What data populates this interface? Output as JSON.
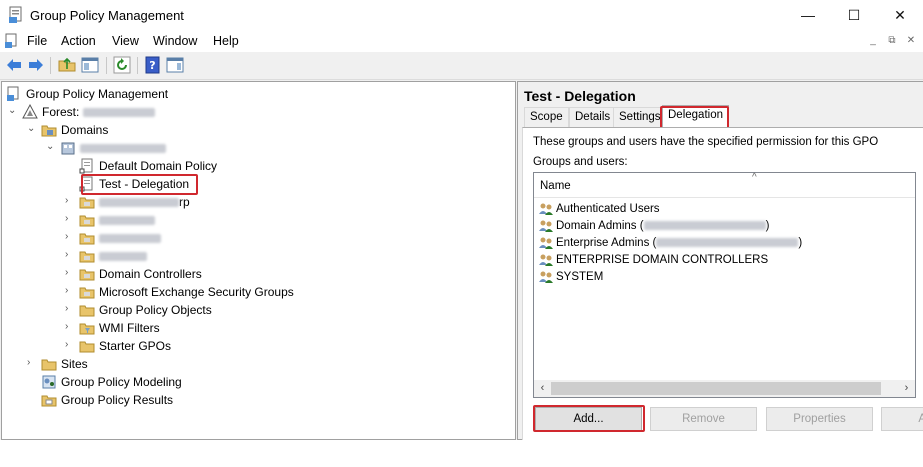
{
  "window": {
    "title": "Group Policy Management",
    "buttons": {
      "minimize": "—",
      "maximize": "☐",
      "close": "✕"
    }
  },
  "menu": {
    "items": [
      "File",
      "Action",
      "View",
      "Window",
      "Help"
    ],
    "mdi": {
      "minimize": "_",
      "restore": "⧉",
      "close": "✕"
    }
  },
  "tree": {
    "root": "Group Policy Management",
    "forest": "Forest:",
    "domains": "Domains",
    "default_domain_policy": "Default Domain Policy",
    "test_delegation": "Test - Delegation",
    "ou_partial": "rp",
    "domain_controllers": "Domain Controllers",
    "exchange_groups": "Microsoft Exchange Security Groups",
    "gpo": "Group Policy Objects",
    "wmi_filters": "WMI Filters",
    "starter_gpos": "Starter GPOs",
    "sites": "Sites",
    "modeling": "Group Policy Modeling",
    "results": "Group Policy Results"
  },
  "details": {
    "title": "Test - Delegation",
    "tabs": [
      "Scope",
      "Details",
      "Settings",
      "Delegation"
    ],
    "active_tab": "Delegation",
    "description": "These groups and users have the specified permission for this GPO",
    "groups_label": "Groups and users:",
    "column_name": "Name",
    "entries": [
      {
        "name": "Authenticated Users"
      },
      {
        "name": "Domain Admins (",
        "suffix": ")"
      },
      {
        "name": "Enterprise Admins (",
        "suffix": ")"
      },
      {
        "name": "ENTERPRISE DOMAIN CONTROLLERS"
      },
      {
        "name": "SYSTEM"
      }
    ],
    "buttons": {
      "add": "Add...",
      "remove": "Remove",
      "properties": "Properties",
      "advanced": "A"
    }
  },
  "colors": {
    "highlight": "#d0282e",
    "folder": "#e8c46a",
    "selection_border": "#d0282e"
  },
  "icons": [
    "gpm-icon",
    "forest-icon",
    "domain-icon",
    "gpo-link-icon",
    "ou-folder-icon",
    "group-icon",
    "back-arrow-icon",
    "forward-arrow-icon",
    "up-folder-icon",
    "refresh-icon",
    "help-icon"
  ]
}
